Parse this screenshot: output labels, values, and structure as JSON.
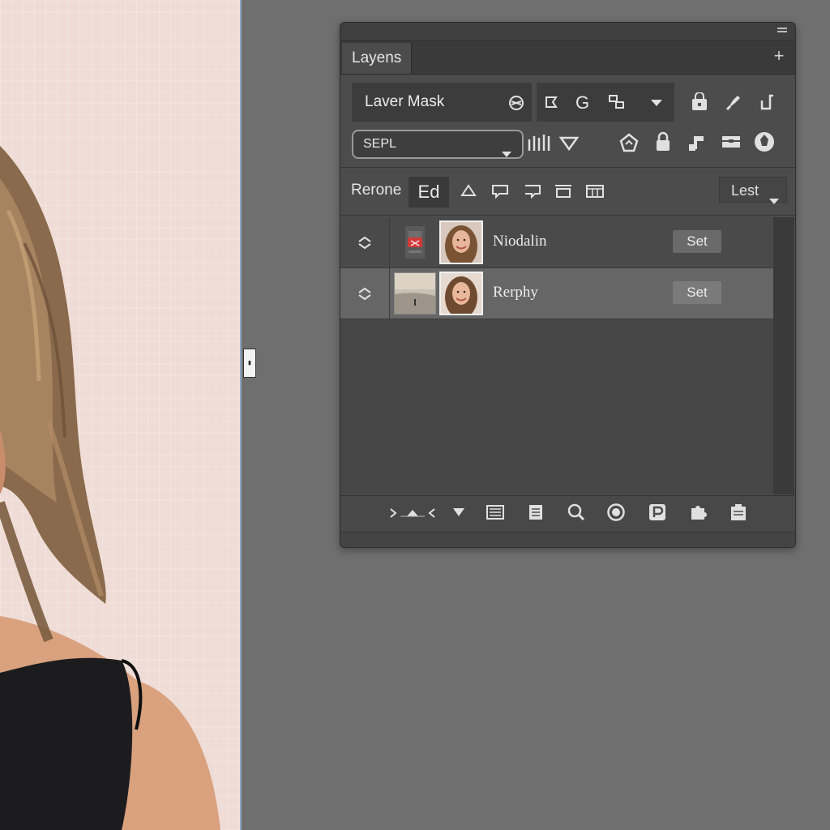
{
  "panel": {
    "tab_label": "Layens",
    "mask_label": "Laver Mask",
    "blend_select": "SEPL",
    "row3_label": "Rerone",
    "edit_button": "Ed",
    "filter_select": "Lest"
  },
  "layers": [
    {
      "name": "Niodalin",
      "button": "Set",
      "selected": false
    },
    {
      "name": "Rerphy",
      "button": "Set",
      "selected": true
    }
  ],
  "icons": {
    "row1": [
      "mask-link-icon",
      "flag-icon",
      "g-icon",
      "transform-icon",
      "dropdown-arrow-icon",
      "bag-lock-icon",
      "brush-icon",
      "crop-corner-icon"
    ],
    "row2": [
      "levels-icon",
      "triangle-down-icon",
      "shape-icon",
      "lock-icon",
      "note-icon",
      "layer-stack-icon",
      "globe-icon"
    ],
    "row3": [
      "triangle-icon",
      "comment-icon",
      "comment-alt-icon",
      "frame-icon",
      "table-icon"
    ],
    "bottom": [
      "link-layers-icon",
      "triangle-down-icon",
      "filter-icon",
      "document-icon",
      "search-icon",
      "target-icon",
      "p-icon",
      "puzzle-icon",
      "clipboard-icon"
    ]
  },
  "colors": {
    "workspace": "#6f6f6f",
    "panel": "#4c4c4c",
    "selected_row": "#666666",
    "canvas_bg": "#efdcd6"
  }
}
